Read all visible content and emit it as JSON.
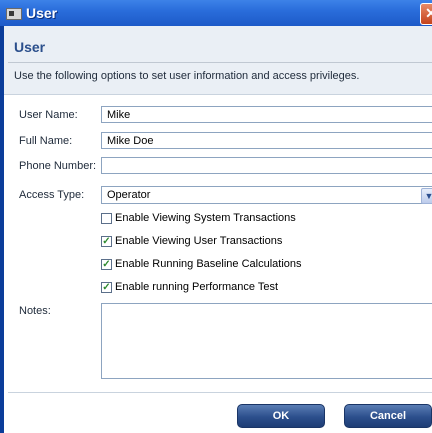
{
  "window": {
    "title": "User",
    "close_glyph": "✕"
  },
  "header": {
    "heading": "User",
    "subtitle": "Use the following options to set user information and access privileges."
  },
  "form": {
    "user_name": {
      "label": "User Name:",
      "value": "Mike"
    },
    "full_name": {
      "label": "Full Name:",
      "value": "Mike Doe"
    },
    "phone_number": {
      "label": "Phone Number:",
      "value": ""
    },
    "access_type": {
      "label": "Access Type:",
      "value": "Operator"
    },
    "checkboxes": [
      {
        "label": "Enable Viewing System Transactions",
        "checked": false
      },
      {
        "label": "Enable Viewing User Transactions",
        "checked": true
      },
      {
        "label": "Enable Running Baseline Calculations",
        "checked": true
      },
      {
        "label": "Enable running Performance Test",
        "checked": true
      }
    ],
    "notes": {
      "label": "Notes:",
      "value": ""
    }
  },
  "buttons": {
    "ok": "OK",
    "cancel": "Cancel"
  },
  "colors": {
    "titlebar": "#2a6ddb",
    "heading": "#2b4f8c",
    "button": "#2c4f8c"
  }
}
